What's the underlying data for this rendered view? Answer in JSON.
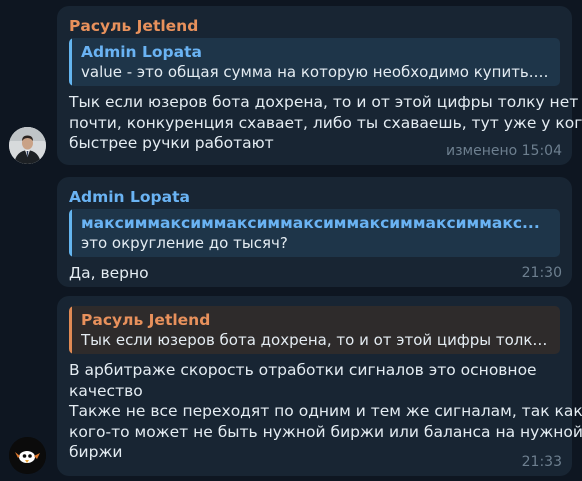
{
  "messages": [
    {
      "sender": "Расуль Jetlend",
      "reply": {
        "name": "Admin Lopata",
        "text": "value - это общая сумма на которую необходимо купить. В..."
      },
      "lines": [
        "Тык если юзеров бота дохрена, то и от этой цифры толку нет",
        "почти, конкуренция схавает, либо ты схаваешь, тут уже у кого",
        "быстрее ручки работают"
      ],
      "time": "изменено 15:04"
    },
    {
      "sender": "Admin Lopata",
      "reply": {
        "name": "максиммаксиммаксиммаксиммаксиммаксиммакс...",
        "text": "это округление до тысяч?"
      },
      "lines": [
        "Да, верно"
      ],
      "time": "21:30"
    },
    {
      "sender": "",
      "reply": {
        "name": "Расуль Jetlend",
        "text": "Тык если юзеров бота дохрена, то и от этой цифры толку н..."
      },
      "lines": [
        "В арбитраже скорость отработки сигналов это основное",
        "качество",
        "Также не все переходят по одним и тем же сигналам, так как у",
        "кого-то может не быть нужной биржи или баланса на нужной",
        "биржи"
      ],
      "time": "21:33"
    }
  ],
  "colors": {
    "background": "#0e1621",
    "bubble": "#182533",
    "orange": "#e8915c",
    "blue": "#6ab3f3"
  }
}
